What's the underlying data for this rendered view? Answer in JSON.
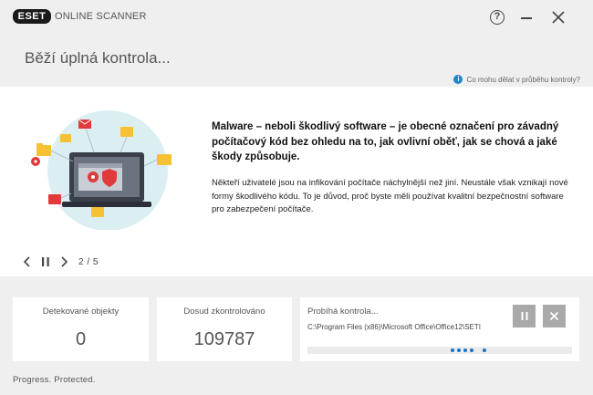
{
  "titlebar": {
    "logo_text": "eset",
    "app_name": "ONLINE SCANNER",
    "help_symbol": "?",
    "icons": [
      "help-icon",
      "minimize-icon",
      "close-icon"
    ]
  },
  "header": {
    "title": "Běží úplná kontrola...",
    "help_link": "Co mohu dělat v průběhu kontroly?",
    "help_icon_text": "i"
  },
  "slide": {
    "heading": "Malware – neboli škodlivý software – je obecné označení pro závadný počítačový kód bez ohledu na to, jak ovlivní oběť, jak se chová a jaké škody způsobuje.",
    "body": "Někteří uživatelé jsou na infikování počítače náchylnější než jiní. Neustále však vznikají nové formy škodlivého kódu. To je důvod, proč byste měli používat kvalitní bezpečnostní software pro zabezpečení počítače.",
    "position": "2 / 5"
  },
  "stats": {
    "detected_label": "Detekované objekty",
    "detected_value": "0",
    "scanned_label": "Dosud zkontrolováno",
    "scanned_value": "109787"
  },
  "progress": {
    "label": "Probíhá kontrola...",
    "path": "C:\\Program Files (x86)\\Microsoft Office\\Office12\\SETI"
  },
  "footer": {
    "text": "Progress. Protected."
  },
  "colors": {
    "accent_blue": "#1a73c8",
    "illustration_bg": "#dbeff3",
    "folder_yellow": "#f6c234",
    "alert_red": "#e03a3a",
    "button_gray": "#a9a9a9"
  }
}
